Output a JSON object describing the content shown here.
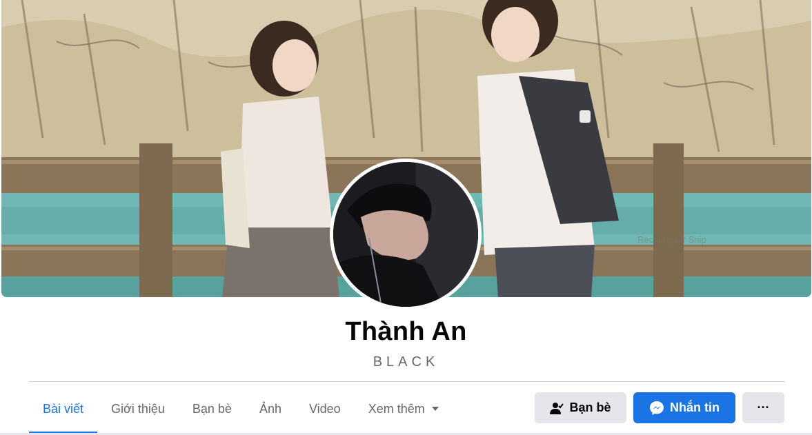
{
  "cover": {
    "overlay_text": "Rectangular Snip"
  },
  "profile": {
    "name": "Thành An",
    "subtitle": "BLACK"
  },
  "tabs": [
    {
      "label": "Bài viết",
      "active": true
    },
    {
      "label": "Giới thiệu",
      "active": false
    },
    {
      "label": "Bạn bè",
      "active": false
    },
    {
      "label": "Ảnh",
      "active": false
    },
    {
      "label": "Video",
      "active": false
    },
    {
      "label": "Xem thêm",
      "active": false
    }
  ],
  "actions": {
    "friends_label": "Bạn bè",
    "message_label": "Nhắn tin",
    "more_label": "···"
  },
  "colors": {
    "accent": "#1b74e4",
    "button_gray": "#e4e6eb",
    "secondary_text": "#65676b"
  }
}
